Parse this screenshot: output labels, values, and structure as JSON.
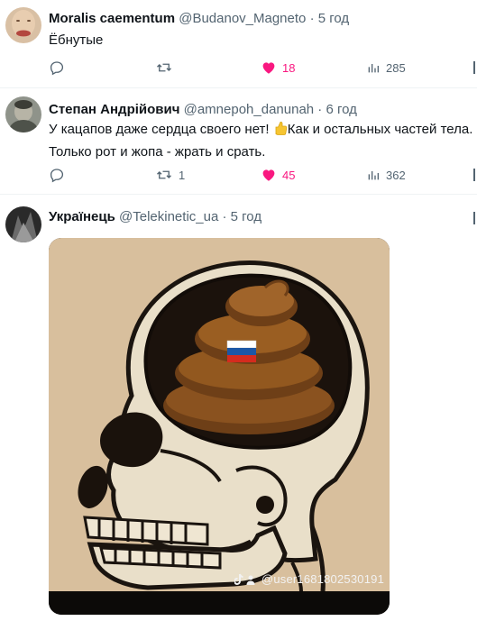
{
  "tweets": [
    {
      "name": "Moralis caementum",
      "handle": "@Budanov_Magneto",
      "separator": "·",
      "time": "5 год",
      "text": "Ёбнутые",
      "replies": "",
      "retweets": "",
      "likes": "18",
      "views": "285",
      "liked": true
    },
    {
      "name": "Степан Андрійович",
      "handle": "@amnepoh_danunah",
      "separator": "·",
      "time": "6 год",
      "text_line1_a": "У кацапов даже сердца своего нет!",
      "text_line1_b": "Как и остальных частей тела.",
      "text_line2": "Только рот и жопа - жрать и срать.",
      "emoji": "thumbs-up-emoji",
      "replies": "",
      "retweets": "1",
      "likes": "45",
      "views": "362",
      "liked": true
    },
    {
      "name": "Українець",
      "handle": "@Telekinetic_ua",
      "separator": "·",
      "time": "5 год",
      "media_watermark": "@user1681802530191"
    }
  ],
  "colors": {
    "like": "#f91880",
    "muted": "#536471",
    "text": "#0f1419",
    "divider": "#eff3f4"
  }
}
